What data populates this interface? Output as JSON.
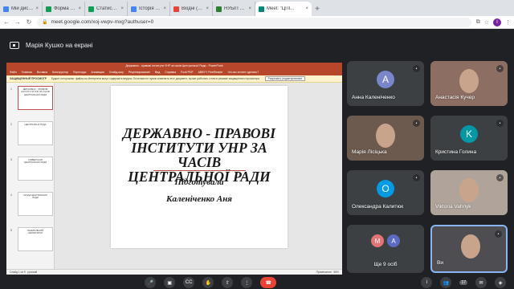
{
  "browser": {
    "tabs": [
      {
        "label": "Мій диск – Goo",
        "favicon_color": "#4285f4"
      },
      {
        "label": "Форма 48_21/22",
        "favicon_color": "#0f9d58"
      },
      {
        "label": "Статистика_Пра",
        "favicon_color": "#0f9d58"
      },
      {
        "label": "Історія ДПУ",
        "favicon_color": "#4285f4"
      },
      {
        "label": "Вхідні (732) - ел",
        "favicon_color": "#ea4335"
      },
      {
        "label": "НУБіП України",
        "favicon_color": "#2e7d32"
      },
      {
        "label": "Meet: \"ЦПІ...",
        "favicon_color": "#00897b"
      }
    ],
    "url": "meet.google.com/xoj-vwpv-mxg?authuser=0",
    "profile_initial": "I"
  },
  "presenting_banner": "Марія Кушко на екрані",
  "powerpoint": {
    "title_bar": "Державно - правові інститути УНР за часів Центральної Ради - PowerPoint",
    "menu": [
      "Файл",
      "Главная",
      "Вставка",
      "Конструктор",
      "Переходы",
      "Анимация",
      "Слайд-шоу",
      "Рецензирование",
      "Вид",
      "Справка",
      "Foxit PDF",
      "ABBYY FineReader",
      "Что вы хотите сделать?"
    ],
    "protected_label": "ЗАЩИЩЕННЫЙ ПРОСМОТР",
    "protected_text": "Будьте осторожны: файлы из Интернета могут содержать вирусы. Если вам не нужно изменять этот документ, лучше работать с ним в режиме защищенного просмотра.",
    "enable_button": "Разрешить редактирование",
    "thumbnails": [
      {
        "num": "1",
        "text": "ДЕРЖАВНО - ПРАВОВІ ІНСТИТУТИ УНР ЗА ЧАСІВ ЦЕНТРАЛЬНОЇ РАДИ"
      },
      {
        "num": "2",
        "text": "ЦЕНТРАЛЬНА РАДА"
      },
      {
        "num": "3",
        "text": "УНІВЕРСАЛИ ЦЕНТРАЛЬНОЇ РАДИ"
      },
      {
        "num": "4",
        "text": "СКЛАД ЦЕНТРАЛЬНОЇ РАДИ"
      },
      {
        "num": "5",
        "text": "ГЕНЕРАЛЬНИЙ СЕКРЕТАРІАТ"
      }
    ],
    "slide": {
      "title_line1": "ДЕРЖАВНО - ПРАВОВІ",
      "title_line2": "ІНСТИТУТИ УНР ЗА ЧАСІВ",
      "title_line3": "ЦЕНТРАЛЬНОЇ РАДИ",
      "prepared_by": "Підготувала",
      "author": "Каленіченко Аня"
    },
    "status_left": "Слайд 1 из 9",
    "status_lang": "русский",
    "status_right": "Примечания",
    "zoom": "56%"
  },
  "participants": [
    {
      "name": "Анна Каленіченко",
      "type": "avatar",
      "initial": "A",
      "color": "#7986cb"
    },
    {
      "name": "Анастасія Кучер",
      "type": "video"
    },
    {
      "name": "Марія Лісіцька",
      "type": "video"
    },
    {
      "name": "Кристина Голина",
      "type": "avatar",
      "initial": "K",
      "color": "#0097a7"
    },
    {
      "name": "Олександра Калитюк",
      "type": "avatar",
      "initial": "O",
      "color": "#039be5"
    },
    {
      "name": "Viktoria Vahnyk",
      "type": "video"
    },
    {
      "name": "Ще 9 осіб",
      "type": "more",
      "initials": [
        "M",
        "A"
      ],
      "colors": [
        "#e57373",
        "#5c6bc0"
      ]
    },
    {
      "name": "Ви",
      "type": "video"
    }
  ],
  "participant_count": "17"
}
